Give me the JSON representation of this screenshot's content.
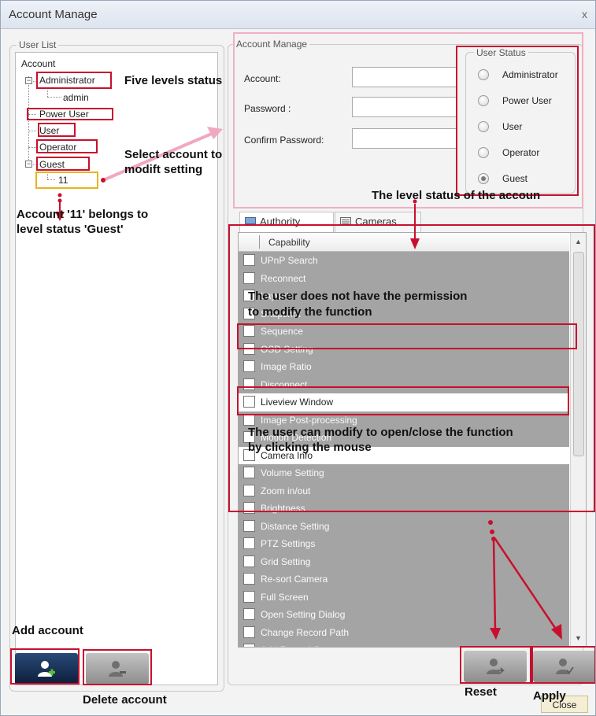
{
  "window": {
    "title": "Account Manage",
    "close_glyph": "x"
  },
  "user_list": {
    "legend": "User List",
    "root": "Account",
    "groups": [
      {
        "label": "Administrator",
        "expander": "−",
        "children": [
          "admin"
        ]
      },
      {
        "label": "Power User"
      },
      {
        "label": "User"
      },
      {
        "label": "Operator"
      },
      {
        "label": "Guest",
        "expander": "−",
        "children": [
          "11"
        ]
      }
    ]
  },
  "account_manage": {
    "legend": "Account Manage",
    "fields": [
      {
        "label": "Account:",
        "value": ""
      },
      {
        "label": "Password :",
        "value": ""
      },
      {
        "label": "Confirm Password:",
        "value": ""
      }
    ],
    "user_status": {
      "legend": "User Status",
      "options": [
        "Administrator",
        "Power User",
        "User",
        "Operator",
        "Guest"
      ],
      "selected": "Guest"
    }
  },
  "tabs": [
    {
      "label": "Authority",
      "active": true,
      "icon": "monitor-icon"
    },
    {
      "label": "Cameras",
      "active": false,
      "icon": "camera-list-icon"
    }
  ],
  "capability": {
    "header": "Capability",
    "rows": [
      {
        "label": "UPnP Search",
        "enabled": false
      },
      {
        "label": "Reconnect",
        "enabled": false
      },
      {
        "label": "Layout",
        "enabled": false
      },
      {
        "label": "Snapshot",
        "enabled": false
      },
      {
        "label": "Sequence",
        "enabled": false
      },
      {
        "label": "OSD Setting",
        "enabled": false
      },
      {
        "label": "Image Ratio",
        "enabled": false
      },
      {
        "label": "Disconnect",
        "enabled": false
      },
      {
        "label": "Liveview Window",
        "enabled": true
      },
      {
        "label": "Image Post-processing",
        "enabled": false
      },
      {
        "label": "Motion Detection",
        "enabled": false
      },
      {
        "label": "Camera Info",
        "enabled": true
      },
      {
        "label": "Volume Setting",
        "enabled": false
      },
      {
        "label": "Zoom in/out",
        "enabled": false
      },
      {
        "label": "Brightness",
        "enabled": false
      },
      {
        "label": "Distance Setting",
        "enabled": false
      },
      {
        "label": "PTZ Settings",
        "enabled": false
      },
      {
        "label": "Grid Setting",
        "enabled": false
      },
      {
        "label": "Re-sort Camera",
        "enabled": false
      },
      {
        "label": "Full Screen",
        "enabled": false
      },
      {
        "label": "Open Setting Dialog",
        "enabled": false
      },
      {
        "label": "Change Record Path",
        "enabled": false
      },
      {
        "label": "Add Record Camera",
        "enabled": false
      }
    ]
  },
  "buttons": {
    "add_icon": "add-user-icon",
    "delete_icon": "delete-user-icon",
    "reset_icon": "reset-user-icon",
    "apply_icon": "apply-user-icon",
    "close": "Close"
  },
  "annotations": {
    "five_levels": "Five levels status",
    "select_account_1": "Select account to",
    "select_account_2": "modift setting",
    "account_11_1": "Account '11' belongs to",
    "account_11_2": "level status 'Guest'",
    "level_status": "The level status of the accoun",
    "no_permission_1": "The user does not have the permission",
    "no_permission_2": "to modify the function",
    "can_modify_1": "The user can modify to open/close the function",
    "can_modify_2": "by clicking the mouse",
    "add_account": "Add account",
    "delete_account": "Delete account",
    "reset": "Reset",
    "apply": "Apply"
  },
  "colors": {
    "annotation_red": "#c8102e",
    "annotation_yellow": "#e8b422",
    "annotation_pink": "#efb0c4",
    "disabled_row": "#a4a4a4"
  }
}
